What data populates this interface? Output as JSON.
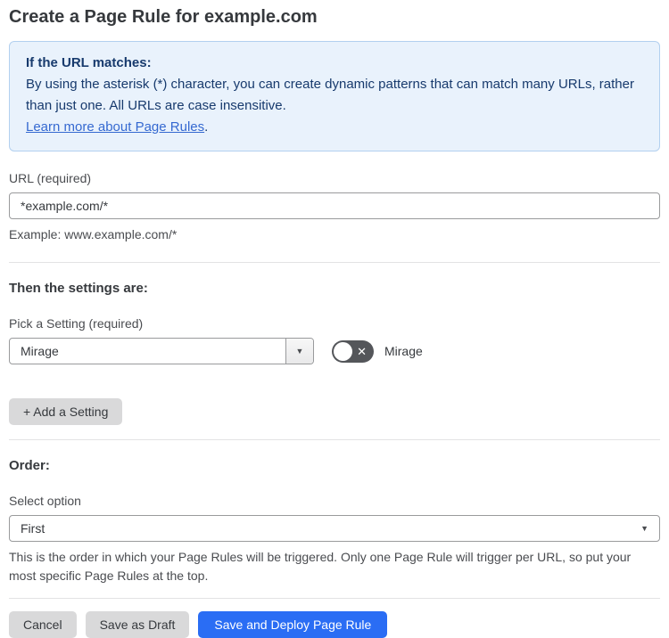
{
  "page": {
    "title": "Create a Page Rule for example.com"
  },
  "info_box": {
    "heading": "If the URL matches:",
    "body": "By using the asterisk (*) character, you can create dynamic patterns that can match many URLs, rather than just one. All URLs are case insensitive.",
    "link_label": "Learn more about Page Rules",
    "link_suffix": "."
  },
  "url_field": {
    "label": "URL (required)",
    "value": "*example.com/*",
    "helper": "Example: www.example.com/*"
  },
  "settings_section": {
    "heading": "Then the settings are:",
    "picker_label": "Pick a Setting (required)",
    "picker_value": "Mirage",
    "toggle_label": "Mirage",
    "toggle_state": "off",
    "add_setting_label": "+ Add a Setting"
  },
  "order_section": {
    "heading": "Order:",
    "select_label": "Select option",
    "select_value": "First",
    "helper": "This is the order in which your Page Rules will be triggered. Only one Page Rule will trigger per URL, so put your most specific Page Rules at the top."
  },
  "footer": {
    "cancel_label": "Cancel",
    "save_draft_label": "Save as Draft",
    "save_deploy_label": "Save and Deploy Page Rule"
  },
  "icons": {
    "dropdown_arrow": "▼",
    "toggle_off_x": "✕"
  },
  "colors": {
    "accent_blue": "#2a6df4",
    "info_bg": "#e9f2fc",
    "info_border": "#b3d0ef",
    "info_text": "#173a6d",
    "link_blue": "#3569d1",
    "toggle_off_bg": "#54565a",
    "button_gray": "#d9d9da"
  }
}
